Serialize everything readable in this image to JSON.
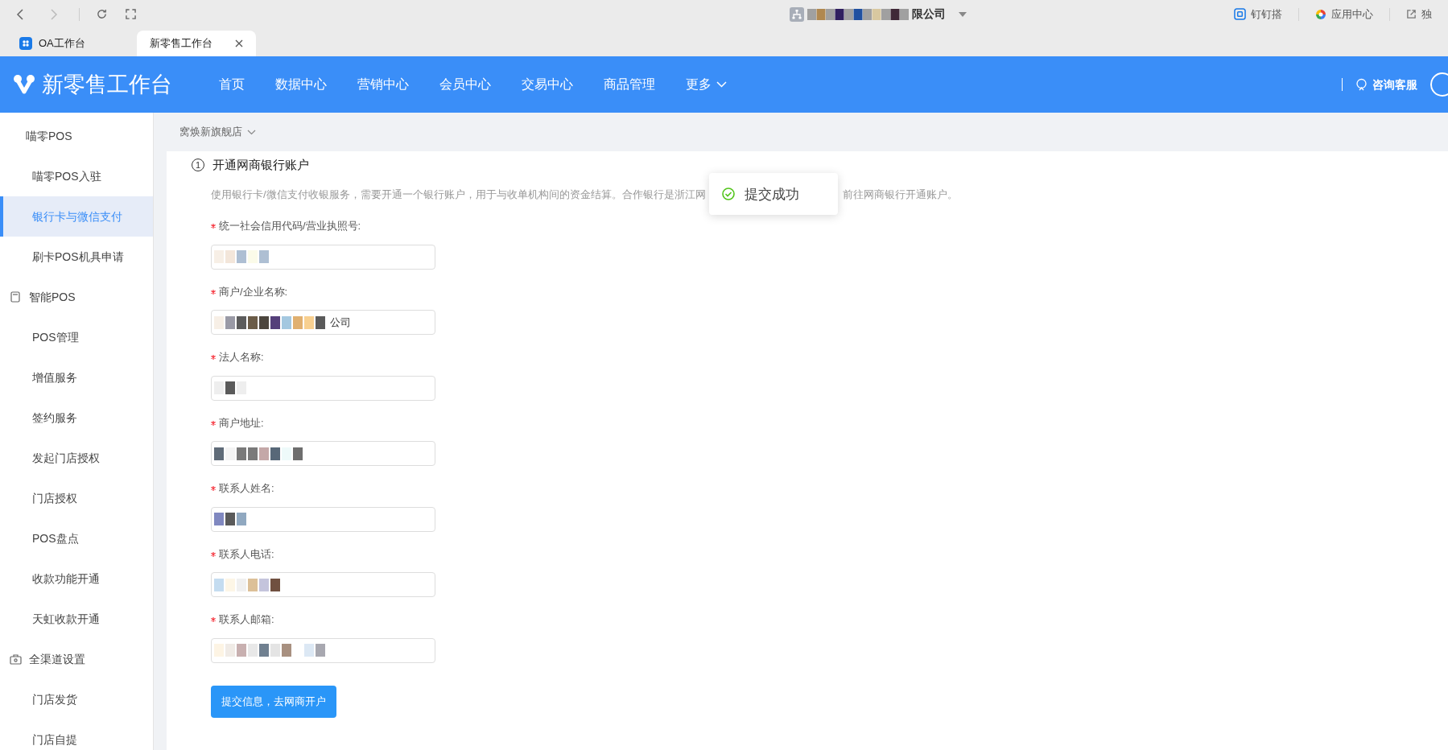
{
  "browser": {
    "title": "限公司",
    "shortcuts": [
      {
        "label": "钉钉搭"
      },
      {
        "label": "应用中心"
      },
      {
        "label": "独"
      }
    ]
  },
  "tabs": [
    {
      "label": "OA工作台",
      "selected": false
    },
    {
      "label": "新零售工作台",
      "selected": true
    }
  ],
  "header": {
    "logo": "新零售工作台",
    "nav": [
      {
        "label": "首页",
        "kind": "link"
      },
      {
        "label": "数据中心",
        "kind": "link"
      },
      {
        "label": "营销中心",
        "kind": "link"
      },
      {
        "label": "会员中心",
        "kind": "link"
      },
      {
        "label": "交易中心",
        "kind": "link"
      },
      {
        "label": "商品管理",
        "kind": "link"
      },
      {
        "label": "更多",
        "kind": "dropdown"
      }
    ],
    "support": "咨询客服"
  },
  "sidebar": {
    "items": [
      {
        "label": "喵零POS",
        "children": [
          {
            "label": "喵零POS入驻",
            "selected": false
          },
          {
            "label": "银行卡与微信支付",
            "selected": true
          },
          {
            "label": "刷卡POS机具申请",
            "selected": false
          }
        ]
      },
      {
        "label": "智能POS",
        "children": [
          {
            "label": "POS管理",
            "selected": false
          },
          {
            "label": "增值服务",
            "selected": false
          },
          {
            "label": "签约服务",
            "selected": false
          },
          {
            "label": "发起门店授权",
            "selected": false
          },
          {
            "label": "门店授权",
            "selected": false
          },
          {
            "label": "POS盘点",
            "selected": false
          },
          {
            "label": "收款功能开通",
            "selected": false
          },
          {
            "label": "天虹收款开通",
            "selected": false
          }
        ]
      },
      {
        "label": "全渠道设置",
        "children": [
          {
            "label": "门店发货",
            "selected": false
          },
          {
            "label": "门店自提",
            "selected": false
          }
        ]
      }
    ]
  },
  "store_selector": "窝焕新旗舰店",
  "form": {
    "step_number": "1",
    "step_title": "开通网商银行账户",
    "description_before": "使用银行卡/微信支付收银服务，需要开通一个银行账户，用于与收单机构间的资金结算。合作银行是浙江网",
    "description_after": "前往网商银行开通账户。",
    "fields": [
      {
        "label": "统一社会信用代码/营业执照号:",
        "required": true
      },
      {
        "label": "商户/企业名称:",
        "required": true,
        "value": "公司"
      },
      {
        "label": "法人名称:",
        "required": true
      },
      {
        "label": "商户地址:",
        "required": true
      },
      {
        "label": "联系人姓名:",
        "required": true
      },
      {
        "label": "联系人电话:",
        "required": true
      },
      {
        "label": "联系人邮箱:",
        "required": true
      }
    ],
    "submit": "提交信息，去网商开户"
  },
  "toast": {
    "kind": "success",
    "message": "提交成功"
  }
}
